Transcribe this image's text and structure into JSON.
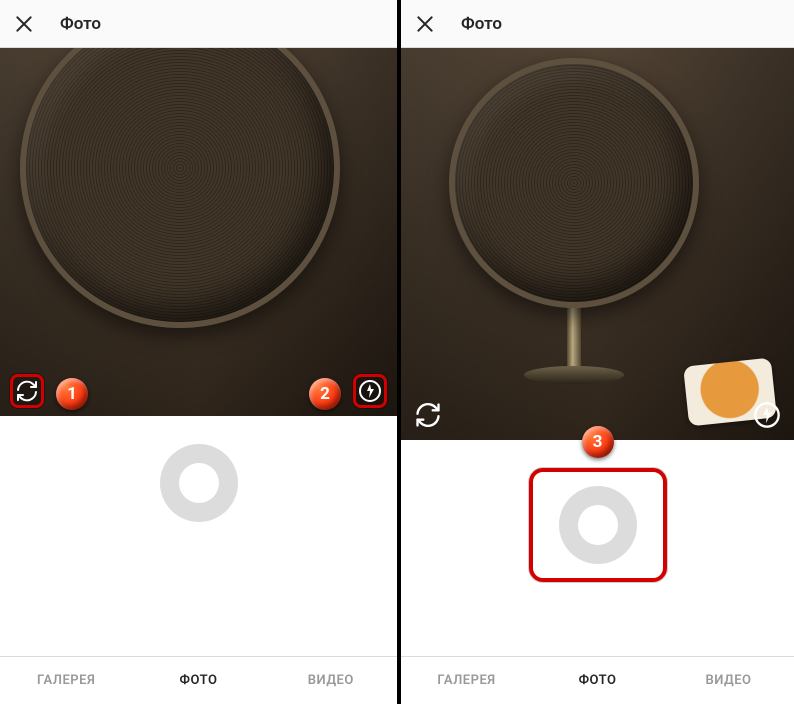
{
  "header": {
    "title": "Фото"
  },
  "tabs": {
    "gallery": "ГАЛЕРЕЯ",
    "photo": "ФОТО",
    "video": "ВИДЕО"
  },
  "callouts": {
    "one": "1",
    "two": "2",
    "three": "3"
  },
  "icons": {
    "close": "close-icon",
    "switch_camera": "switch-camera-icon",
    "flash": "flash-icon",
    "shutter": "shutter-button"
  }
}
